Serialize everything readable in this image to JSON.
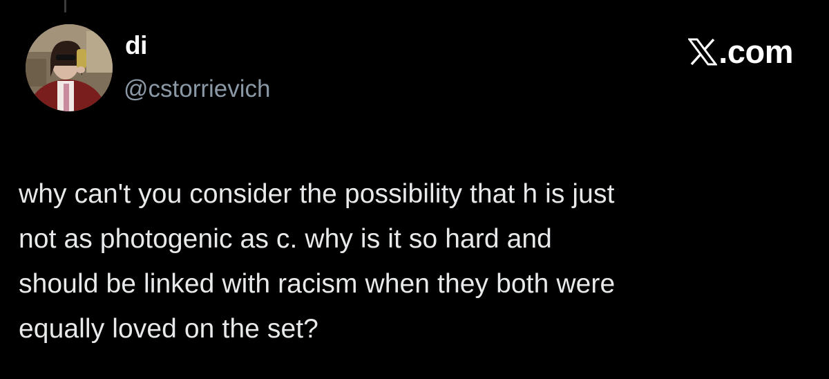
{
  "author": {
    "display_name": "di",
    "handle": "@cstorrievich",
    "avatar_icon": "profile-photo"
  },
  "brand": {
    "label": ".com",
    "icon": "x-logo-icon"
  },
  "tweet": {
    "lines": [
      "why can't you consider the possibility that h is just",
      "not as photogenic as c. why is it so hard and",
      "should be linked with racism when they both were",
      "equally loved on the set?"
    ]
  },
  "colors": {
    "background": "#000000",
    "primary_text": "#e7e9ea",
    "secondary_text": "#8b98a5"
  }
}
